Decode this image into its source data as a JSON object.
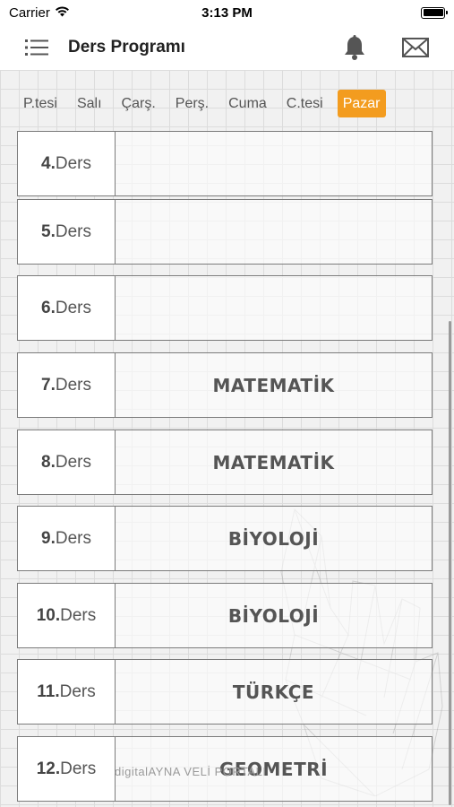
{
  "status": {
    "carrier": "Carrier",
    "time": "3:13 PM"
  },
  "nav": {
    "title": "Ders Programı"
  },
  "days": [
    {
      "label": "P.tesi",
      "active": false
    },
    {
      "label": "Salı",
      "active": false
    },
    {
      "label": "Çarş.",
      "active": false
    },
    {
      "label": "Perş.",
      "active": false
    },
    {
      "label": "Cuma",
      "active": false
    },
    {
      "label": "C.tesi",
      "active": false
    },
    {
      "label": "Pazar",
      "active": true
    }
  ],
  "lesson_suffix": "Ders",
  "lessons": [
    {
      "num": "4.",
      "subject": ""
    },
    {
      "num": "5.",
      "subject": ""
    },
    {
      "num": "6.",
      "subject": ""
    },
    {
      "num": "7.",
      "subject": "MATEMATİK"
    },
    {
      "num": "8.",
      "subject": "MATEMATİK"
    },
    {
      "num": "9.",
      "subject": "BİYOLOJİ"
    },
    {
      "num": "10.",
      "subject": "BİYOLOJİ"
    },
    {
      "num": "11.",
      "subject": "TÜRKÇE"
    },
    {
      "num": "12.",
      "subject": "GEOMETRİ"
    }
  ],
  "watermark": "digitalAYNA VELİ PORTALI",
  "colors": {
    "accent": "#f39c1f",
    "border": "#7b7b7b",
    "text": "#555555"
  }
}
